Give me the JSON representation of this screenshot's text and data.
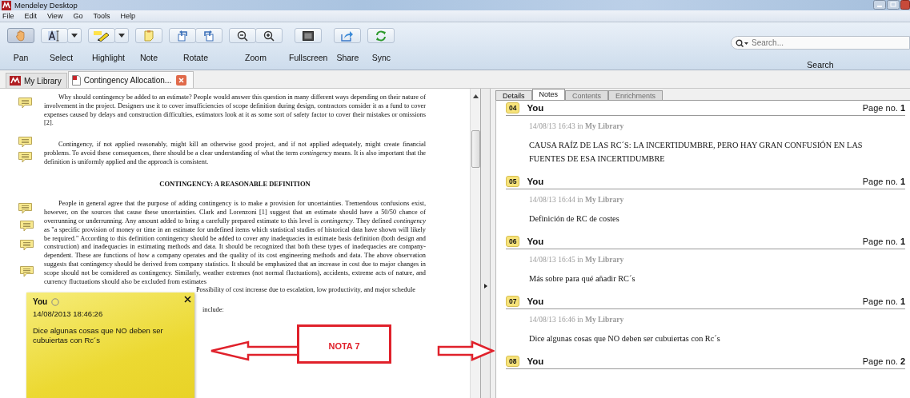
{
  "window": {
    "title": "Mendeley Desktop"
  },
  "menu": [
    "File",
    "Edit",
    "View",
    "Go",
    "Tools",
    "Help"
  ],
  "toolbar": [
    {
      "label": "Pan",
      "selected": true,
      "dropdown": false
    },
    {
      "label": "Select",
      "selected": false,
      "dropdown": true
    },
    {
      "label": "Highlight",
      "selected": false,
      "dropdown": true
    },
    {
      "label": "Note",
      "selected": false,
      "dropdown": false
    },
    {
      "label": "Rotate",
      "selected": false,
      "dropdown": false
    },
    {
      "label": "Zoom",
      "selected": false,
      "dropdown": false
    },
    {
      "label": "Fullscreen",
      "selected": false,
      "dropdown": false
    },
    {
      "label": "Share",
      "selected": false,
      "dropdown": false
    },
    {
      "label": "Sync",
      "selected": false,
      "dropdown": false
    }
  ],
  "search": {
    "placeholder": "Search...",
    "label": "Search"
  },
  "doc_tabs": [
    {
      "label": "My Library",
      "selected": false,
      "kind": "library"
    },
    {
      "label": "Contingency Allocation...",
      "selected": true,
      "kind": "pdf"
    }
  ],
  "document": {
    "blocks": [
      {
        "kind": "paragraph",
        "text": "Why should contingency be added to an estimate? People would answer this question in many different ways depending on their nature of involvement in the project. Designers use it to cover insufficiencies of scope definition during design, contractors consider it as a fund to cover expenses caused by delays and construction difficulties, estimators look at it as some sort of safety factor to cover their mistakes or omissions [2]."
      },
      {
        "kind": "paragraph",
        "text": "Contingency, if not applied reasonably, might kill an otherwise good project, and if not applied adequately, might create financial problems. To avoid these consequences, there should be a clear understanding of what the term *contingency* means. It is also important that the definition is uniformly applied and the approach is consistent."
      },
      {
        "kind": "heading",
        "text": "CONTINGENCY: A REASONABLE DEFINITION"
      },
      {
        "kind": "paragraph",
        "text": "People in general agree that the purpose of adding contingency is to make a provision for uncertainties. Tremendous confusions exist, however, on the sources that cause these uncertainties. Clark and Lorenzoni [1] suggest that an estimate should have a 50/50 chance of overrunning or underrunning. Any amount added to bring a carefully prepared estimate to this level is *contingency*. They defined *contingency* as \"a specific provision of money or time in an estimate for undefined items which statistical studies of historical data have shown will likely be required.\" According to this definition contingency should be added to cover any inadequacies in estimate basis definition (both design and construction) and inadequacies in estimating methods and data. It should be recognized that both these types of inadequacies are company-dependent. These are functions of how a company operates and the quality of its cost engineering methods and data. The above observation suggests that contingency should be derived from company statistics. It should be emphasized that an increase in cost due to major changes in scope should not be considered as contingency. Similarly, weather extremes (not normal fluctuations), accidents, extreme acts of nature, and currency fluctuations should also be excluded from estimates"
      },
      {
        "kind": "fragment",
        "text": "Possibility of cost increase due to escalation, low productivity, and major schedule"
      },
      {
        "kind": "fragment_short",
        "text": "include:"
      }
    ]
  },
  "sticky_note": {
    "author": "You",
    "date": "14/08/2013 18:46:26",
    "text": "Dice algunas cosas que NO deben ser cubuiertas con Rc´s"
  },
  "annotation": {
    "label": "NOTA 7"
  },
  "panel_tabs": [
    {
      "label": "Details",
      "selected": false,
      "disabled": false
    },
    {
      "label": "Notes",
      "selected": true,
      "disabled": false
    },
    {
      "label": "Contents",
      "selected": false,
      "disabled": true
    },
    {
      "label": "Enrichments",
      "selected": false,
      "disabled": true
    }
  ],
  "notes": [
    {
      "number": "04",
      "author": "You",
      "page": "Page no. **1**",
      "meta": "14/08/13 16:43 in **My Library**",
      "text": "CAUSA RAÍZ DE LAS RC´S: LA INCERTIDUMBRE, PERO HAY GRAN CONFUSIÓN EN LAS FUENTES DE ESA INCERTIDUMBRE"
    },
    {
      "number": "05",
      "author": "You",
      "page": "Page no. **1**",
      "meta": "14/08/13 16:44 in **My Library**",
      "text": "Definición de RC de costes"
    },
    {
      "number": "06",
      "author": "You",
      "page": "Page no. **1**",
      "meta": "14/08/13 16:45 in **My Library**",
      "text": "Más sobre para qué añadir RC´s"
    },
    {
      "number": "07",
      "author": "You",
      "page": "Page no. **1**",
      "meta": "14/08/13 16:46 in **My Library**",
      "text": "Dice algunas cosas que NO deben ser cubuiertas con Rc´s"
    },
    {
      "number": "08",
      "author": "You",
      "page": "Page no. **2**"
    }
  ]
}
